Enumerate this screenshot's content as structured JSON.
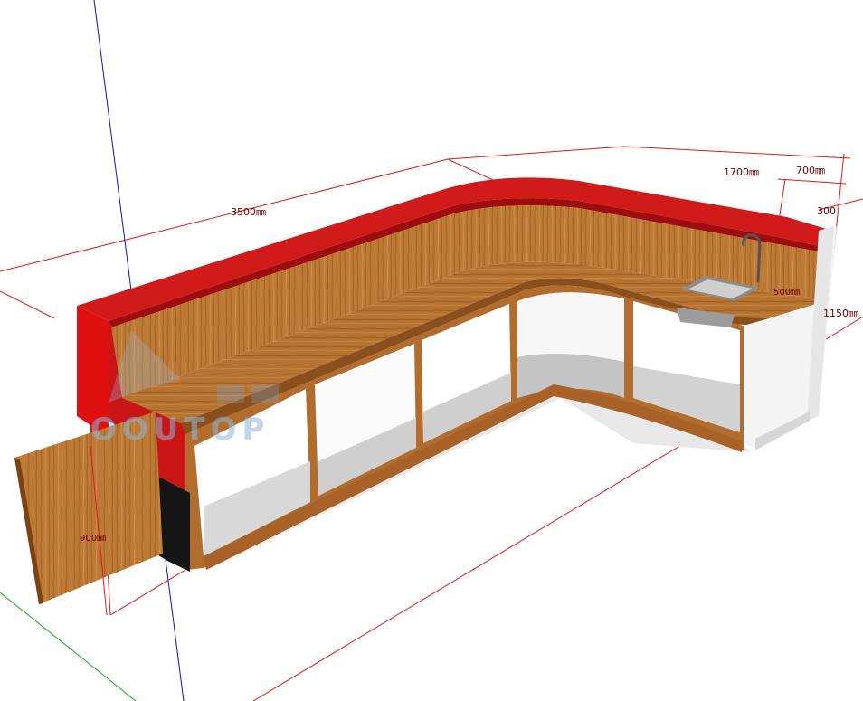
{
  "dimensions": {
    "length_main": "3500㎜",
    "length_side": "1700㎜",
    "depth": "700㎜",
    "top_width": "300",
    "height": "1150㎜",
    "door_height": "900㎜",
    "sink_offset": "500㎜"
  },
  "watermark": {
    "text": "OOUTOP"
  },
  "colors": {
    "red_top": "#d11a1a",
    "wood": "#b8732f",
    "wood_dark": "#8a4f1c",
    "interior": "#f2f2f2",
    "floor_shadow": "#bdbdbd",
    "dimension_line": "#e01818",
    "axis_blue": "#1010c0",
    "axis_green": "#13a813"
  }
}
